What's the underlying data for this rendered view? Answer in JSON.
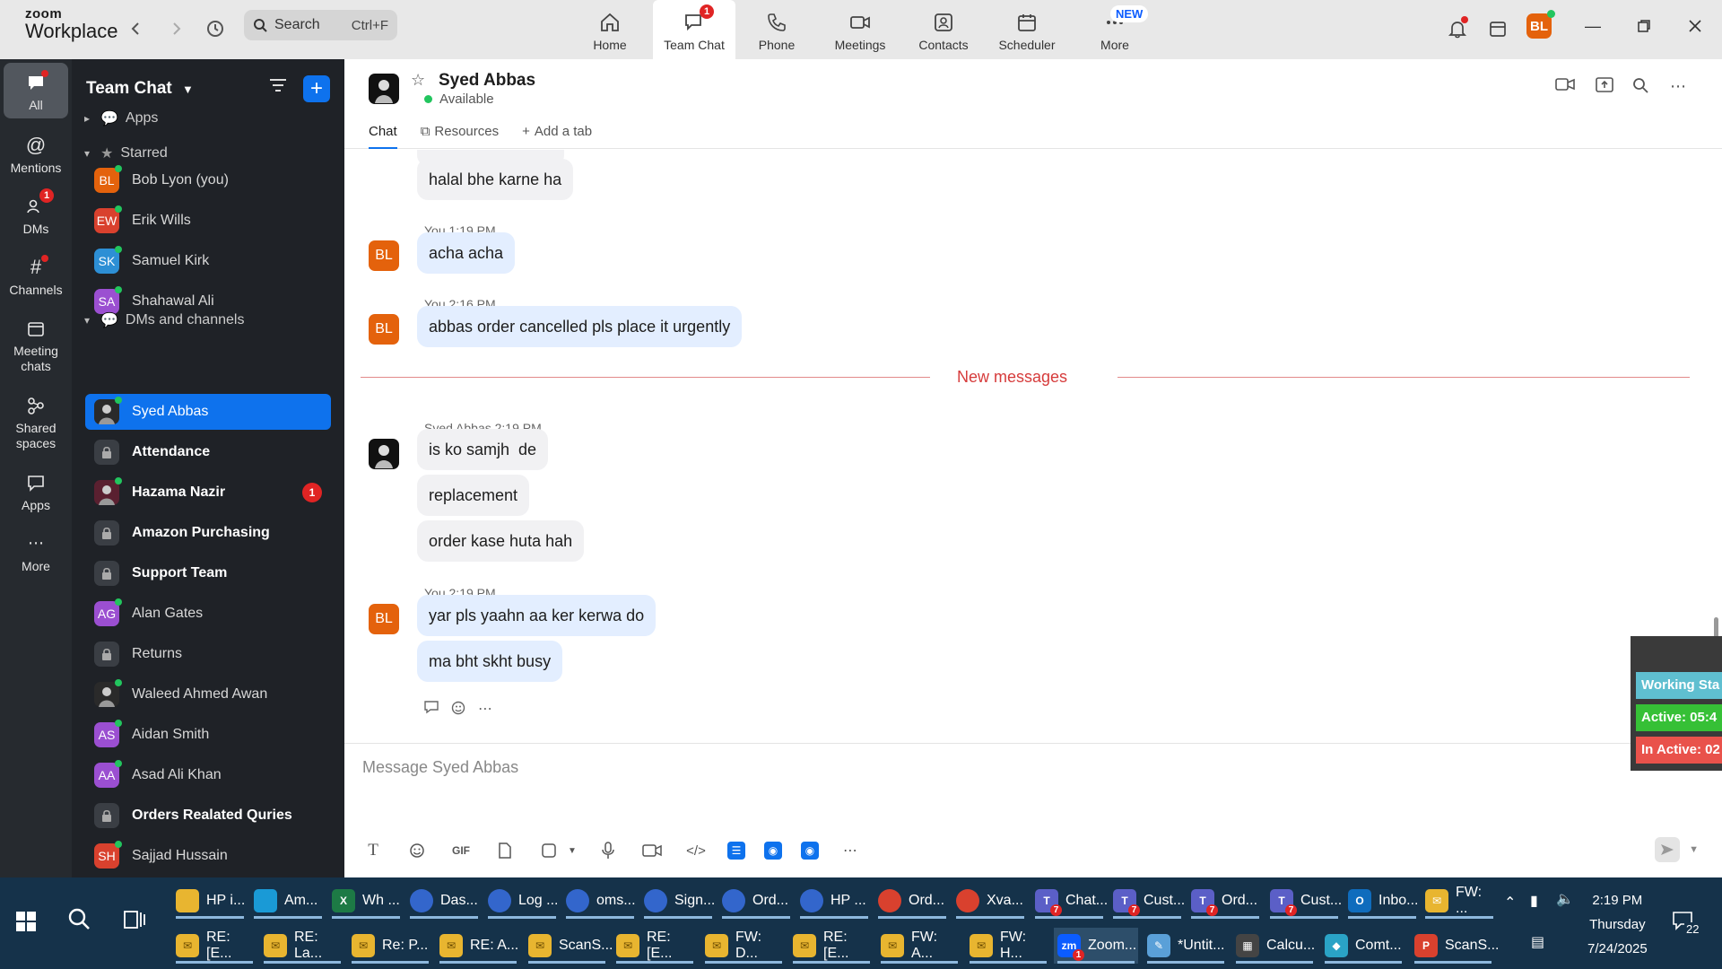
{
  "app": {
    "logo_line1": "zoom",
    "logo_line2": "Workplace"
  },
  "topbar": {
    "search_label": "Search",
    "search_shortcut": "Ctrl+F",
    "nav": [
      {
        "label": "Home",
        "icon": "home-icon"
      },
      {
        "label": "Team Chat",
        "icon": "chat-icon",
        "badge": "1",
        "active": true
      },
      {
        "label": "Phone",
        "icon": "phone-icon"
      },
      {
        "label": "Meetings",
        "icon": "video-icon"
      },
      {
        "label": "Contacts",
        "icon": "contacts-icon"
      },
      {
        "label": "Scheduler",
        "icon": "calendar-icon"
      },
      {
        "label": "More",
        "icon": "more-icon",
        "pill": "NEW"
      }
    ],
    "profile_initials": "BL"
  },
  "rail": {
    "items": [
      {
        "label": "All",
        "icon": "chat-bubble-icon"
      },
      {
        "label": "Mentions",
        "icon": "at-icon"
      },
      {
        "label": "DMs",
        "icon": "people-icon",
        "badge": "1"
      },
      {
        "label": "Channels",
        "icon": "hash-icon"
      },
      {
        "label": "Meeting chats",
        "icon": "calendar-icon"
      },
      {
        "label": "Shared spaces",
        "icon": "shared-spaces-icon"
      },
      {
        "label": "Apps",
        "icon": "apps-icon"
      },
      {
        "label": "More",
        "icon": "more-icon"
      }
    ]
  },
  "chatlist": {
    "title": "Team Chat",
    "sections": {
      "apps": "Apps",
      "starred": "Starred",
      "dms": "DMs and channels"
    },
    "starred": [
      {
        "name": "Bob Lyon (you)",
        "initials": "BL",
        "color": "#e4620c"
      },
      {
        "name": "Erik Wills",
        "initials": "EW",
        "color": "#d9412e"
      },
      {
        "name": "Samuel Kirk",
        "initials": "SK",
        "color": "#2d8fd5"
      },
      {
        "name": "Shahawal Ali",
        "initials": "SA",
        "color": "#9b4fd1"
      }
    ],
    "dms": [
      {
        "name": "Syed Abbas",
        "selected": true
      },
      {
        "name": "Attendance",
        "bold": true,
        "locked": true
      },
      {
        "name": "Hazama Nazir",
        "bold": true,
        "badge": "1"
      },
      {
        "name": "Amazon Purchasing",
        "bold": true,
        "locked": true
      },
      {
        "name": "Support Team",
        "bold": true,
        "locked": true
      },
      {
        "name": "Alan Gates",
        "initials": "AG",
        "color": "#9b4fd1"
      },
      {
        "name": "Returns",
        "locked": true
      },
      {
        "name": "Waleed Ahmed Awan"
      },
      {
        "name": "Aidan Smith",
        "initials": "AS",
        "color": "#9b4fd1"
      },
      {
        "name": "Asad Ali Khan",
        "initials": "AA",
        "color": "#9b4fd1"
      },
      {
        "name": "Orders Realated Quries",
        "bold": true,
        "locked": true
      },
      {
        "name": "Sajjad Hussain",
        "initials": "SH",
        "color": "#d9412e"
      }
    ]
  },
  "chat": {
    "name": "Syed Abbas",
    "status": "Available",
    "tabs": [
      "Chat",
      "Resources",
      "Add a tab"
    ],
    "messages": {
      "m0": "halal bhe karne ha",
      "h1": "You 1:19 PM",
      "m1": "acha acha",
      "h2": "You 2:16 PM",
      "m2": "abbas order cancelled pls place it urgently",
      "divider": "New messages",
      "h3": "Syed Abbas 2:19 PM",
      "m3": "is ko samjh  de",
      "m4": "replacement",
      "m5": "order kase huta hah",
      "h4": "You 2:19 PM",
      "m6": "yar pls yaahn aa ker kerwa do",
      "m7": "ma bht skht busy"
    },
    "composer_placeholder": "Message Syed Abbas",
    "initials_me": "BL"
  },
  "work_status": {
    "title": "Working Sta",
    "active": "Active: 05:4",
    "inactive": "In Active: 02"
  },
  "taskbar": {
    "row1": [
      {
        "label": "HP i...",
        "icon": "folder-icon",
        "color": "#e8b530"
      },
      {
        "label": "Am...",
        "icon": "edge-icon",
        "color": "#1a9ad6"
      },
      {
        "label": "Wh ...",
        "icon": "excel-icon",
        "color": "#1d7a45",
        "glyph": "X"
      },
      {
        "label": "Das...",
        "icon": "chrome-icon",
        "color": "#3366cc"
      },
      {
        "label": "Log ...",
        "icon": "chrome-icon",
        "color": "#3366cc"
      },
      {
        "label": "oms...",
        "icon": "chrome-icon",
        "color": "#3366cc"
      },
      {
        "label": "Sign...",
        "icon": "chrome-icon",
        "color": "#3366cc"
      },
      {
        "label": "Ord...",
        "icon": "chrome-icon",
        "color": "#3366cc"
      },
      {
        "label": "HP ...",
        "icon": "chrome-icon",
        "color": "#3366cc"
      },
      {
        "label": "Ord...",
        "icon": "chrome-icon",
        "color": "#d9412e"
      },
      {
        "label": "Xva...",
        "icon": "chrome-icon",
        "color": "#d9412e"
      },
      {
        "label": "Chat...",
        "icon": "teams-icon",
        "color": "#5b5fc7",
        "glyph": "T",
        "badge": "7"
      },
      {
        "label": "Cust...",
        "icon": "teams-icon",
        "color": "#5b5fc7",
        "glyph": "T",
        "badge": "7"
      },
      {
        "label": "Ord...",
        "icon": "teams-icon",
        "color": "#5b5fc7",
        "glyph": "T",
        "badge": "7"
      },
      {
        "label": "Cust...",
        "icon": "teams-icon",
        "color": "#5b5fc7",
        "glyph": "T",
        "badge": "7"
      },
      {
        "label": "Inbo...",
        "icon": "outlook-icon",
        "color": "#0f6cbd",
        "glyph": "O"
      },
      {
        "label": "FW: ...",
        "icon": "mail-icon",
        "color": "#e8b530",
        "glyph": "✉"
      }
    ],
    "row2": [
      {
        "label": "RE: [E...",
        "icon": "mail-icon"
      },
      {
        "label": "RE: La...",
        "icon": "mail-icon"
      },
      {
        "label": "Re: P...",
        "icon": "mail-icon"
      },
      {
        "label": "RE: A...",
        "icon": "mail-icon"
      },
      {
        "label": "ScanS...",
        "icon": "mail-icon"
      },
      {
        "label": "RE: [E...",
        "icon": "mail-icon"
      },
      {
        "label": "FW: D...",
        "icon": "mail-icon"
      },
      {
        "label": "RE: [E...",
        "icon": "mail-icon"
      },
      {
        "label": "FW: A...",
        "icon": "mail-icon"
      },
      {
        "label": "FW: H...",
        "icon": "mail-icon"
      },
      {
        "label": "Zoom...",
        "icon": "zoom-icon",
        "active": true,
        "badge": "1"
      },
      {
        "label": "*Untit...",
        "icon": "notepad-icon"
      },
      {
        "label": "Calcu...",
        "icon": "calculator-icon"
      },
      {
        "label": "Comt...",
        "icon": "app-icon"
      },
      {
        "label": "ScanS...",
        "icon": "pdf-icon"
      }
    ],
    "time": "2:19 PM",
    "day": "Thursday",
    "date": "7/24/2025",
    "notif_count": "22"
  }
}
